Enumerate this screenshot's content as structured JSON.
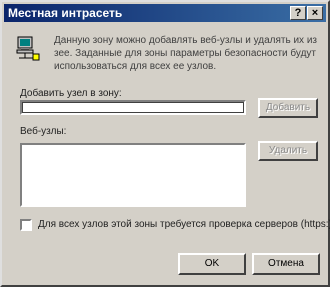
{
  "window": {
    "title": "Местная интрасеть",
    "help_glyph": "?",
    "close_glyph": "×"
  },
  "description": "Данную зону можно добавлять веб-узлы и удалять их из зее. Заданные для зоны параметры безопасности будут использоваться для всех ее узлов.",
  "add_site": {
    "label": "Добавить узел в зону:",
    "value": "",
    "button_label": "Добавить"
  },
  "sites": {
    "label": "Веб-узлы:",
    "items": [],
    "remove_label": "Удалить"
  },
  "require_https": {
    "checked": false,
    "label": "Для всех узлов этой зоны требуется проверка серверов (https:)"
  },
  "footer": {
    "ok_label": "OK",
    "cancel_label": "Отмена"
  },
  "icons": {
    "zone": "network-computer-icon"
  }
}
